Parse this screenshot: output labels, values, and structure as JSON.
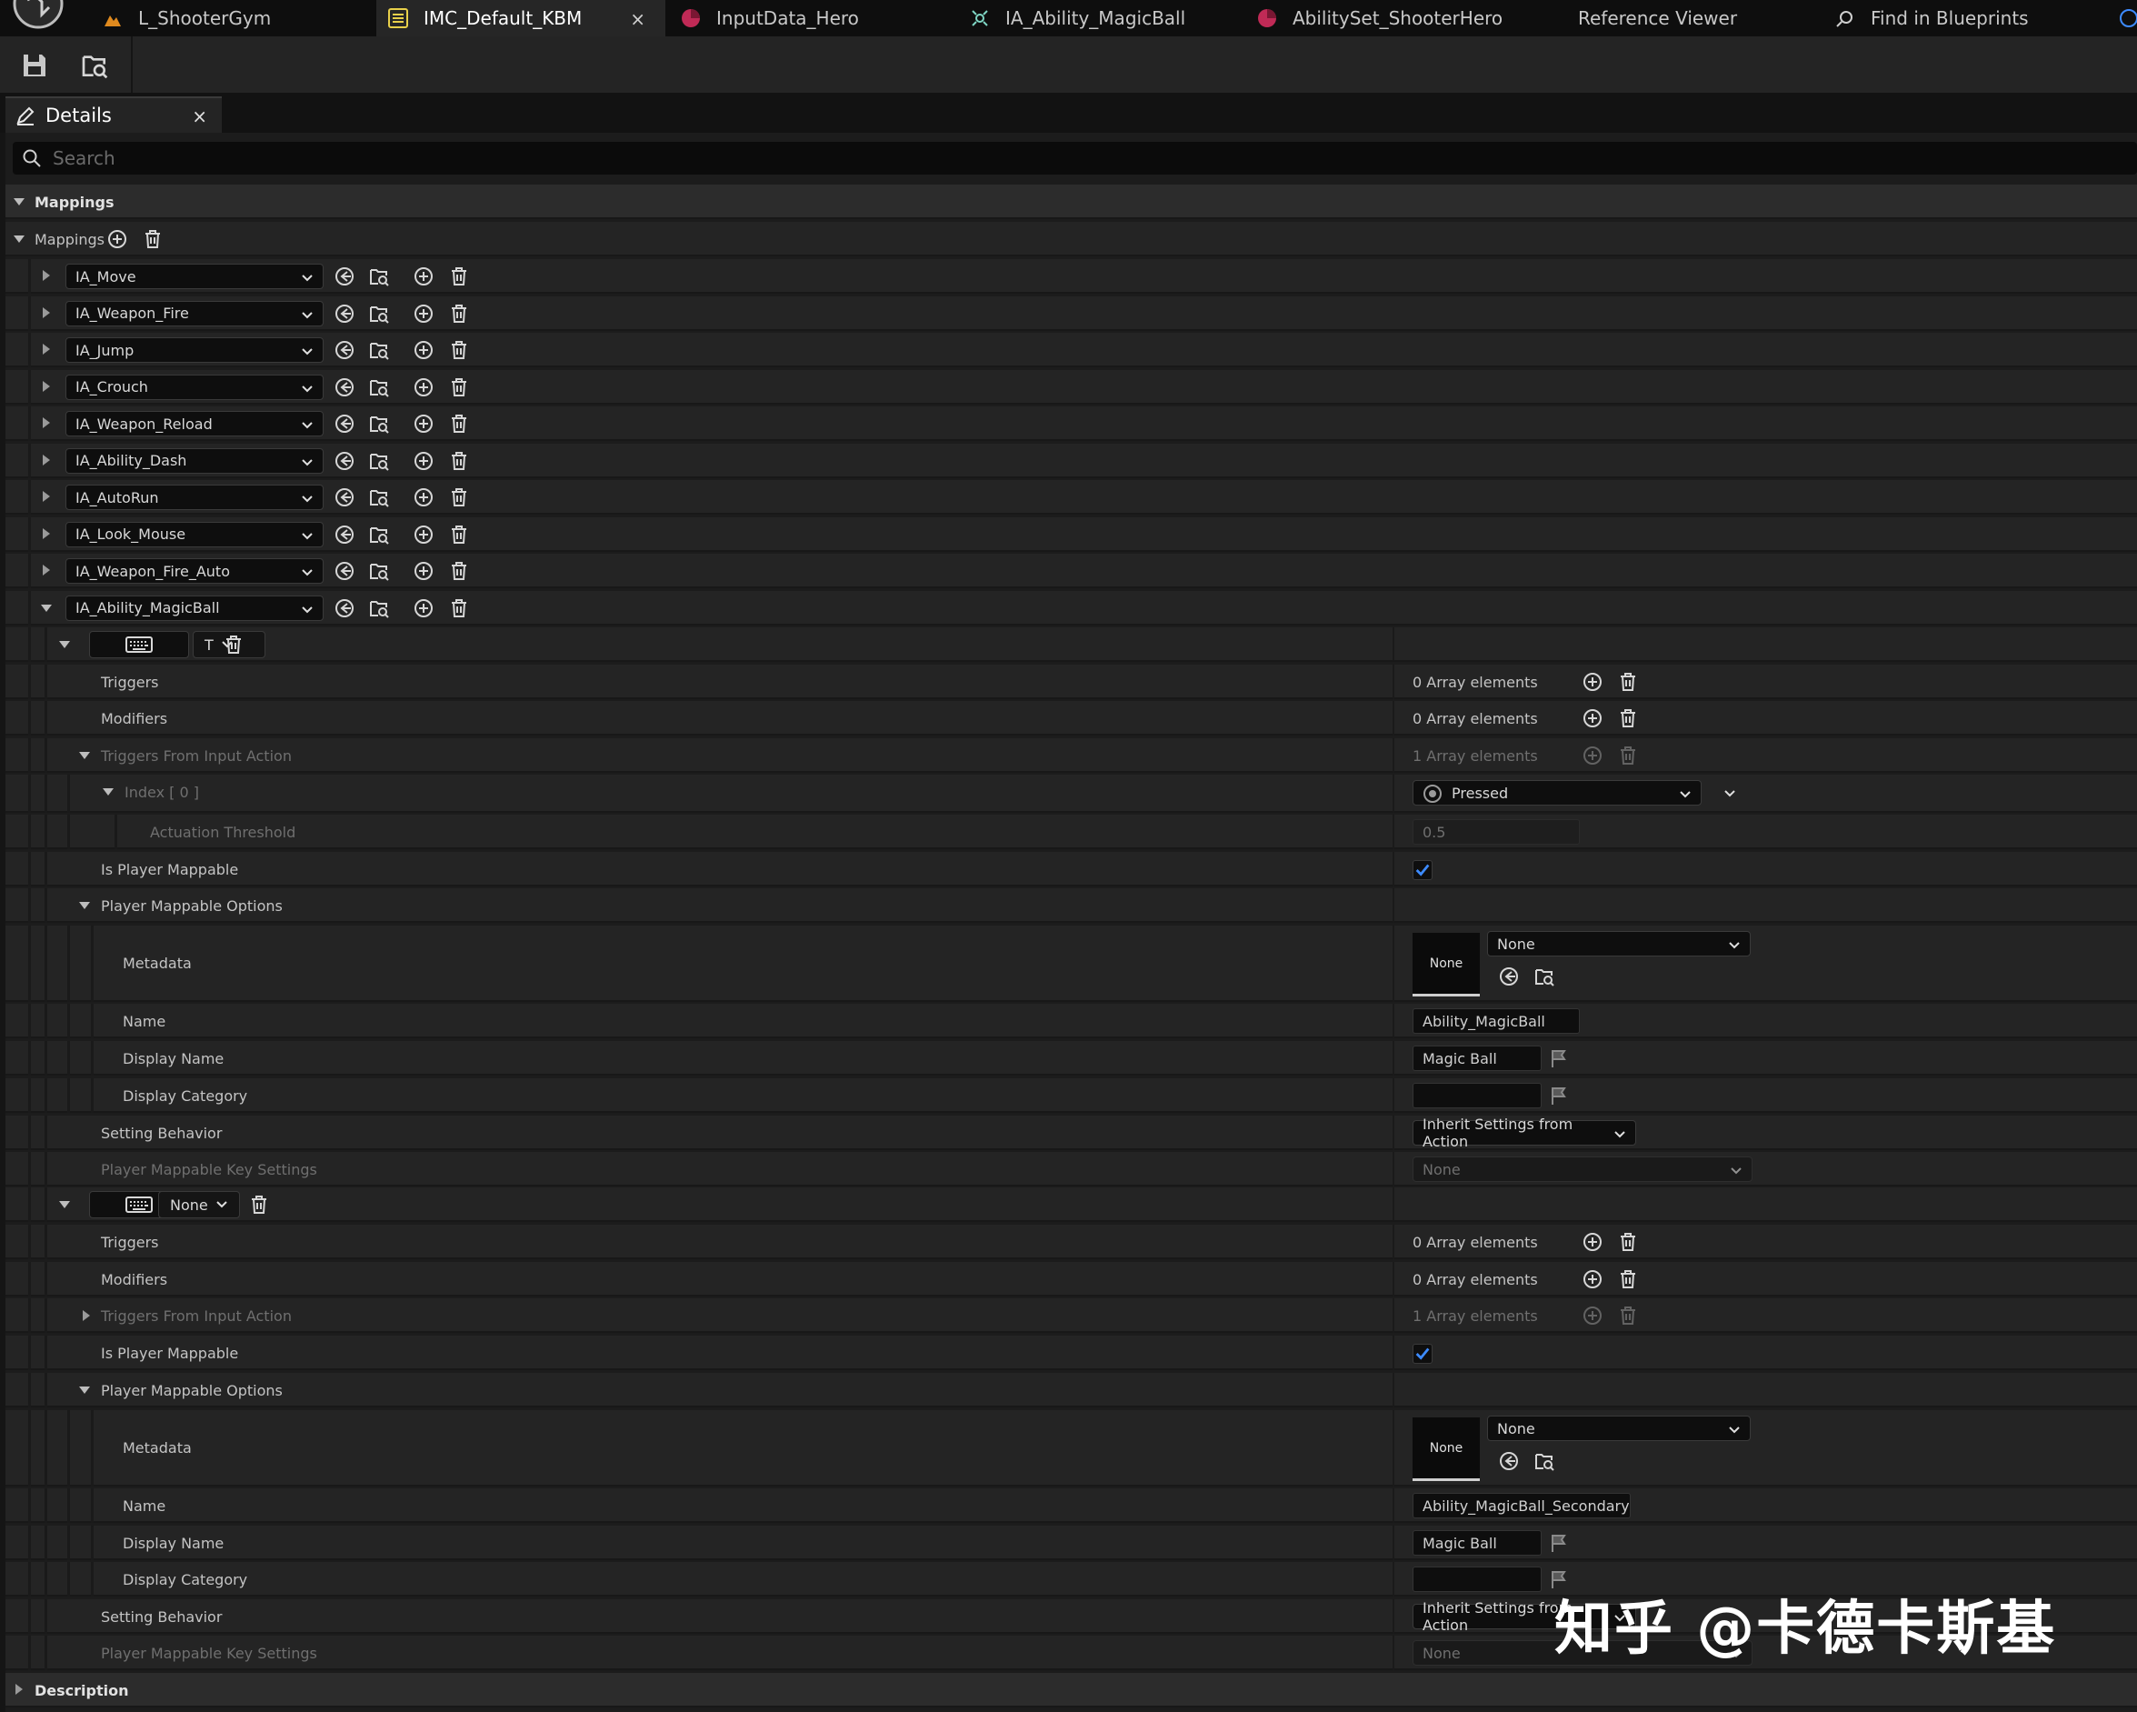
{
  "tabs": [
    {
      "label": "L_ShooterGym",
      "icon": "level-icon",
      "active": false
    },
    {
      "label": "IMC_Default_KBM",
      "icon": "input-mapping-context-icon",
      "active": true,
      "close": "×"
    },
    {
      "label": "InputData_Hero",
      "icon": "data-asset-icon",
      "active": false
    },
    {
      "label": "IA_Ability_MagicBall",
      "icon": "input-action-icon",
      "active": false
    },
    {
      "label": "AbilitySet_ShooterHero",
      "icon": "data-asset-icon",
      "active": false
    },
    {
      "label": "Reference Viewer",
      "icon": "",
      "active": false
    },
    {
      "label": "Find in Blueprints",
      "icon": "find-icon",
      "active": false
    }
  ],
  "toolbar": {
    "save_icon": "save-icon",
    "browse_icon": "browse-asset-icon"
  },
  "details": {
    "title": "Details",
    "close": "×",
    "search_placeholder": "Search"
  },
  "categories": {
    "mappings": "Mappings",
    "description": "Description"
  },
  "mappings_header": {
    "label": "Mappings"
  },
  "actions": [
    "IA_Move",
    "IA_Weapon_Fire",
    "IA_Jump",
    "IA_Crouch",
    "IA_Weapon_Reload",
    "IA_Ability_Dash",
    "IA_AutoRun",
    "IA_Look_Mouse",
    "IA_Weapon_Fire_Auto",
    "IA_Ability_MagicBall"
  ],
  "mapping1": {
    "key": "T",
    "triggers": {
      "label": "Triggers",
      "value": "0 Array elements"
    },
    "modifiers": {
      "label": "Modifiers",
      "value": "0 Array elements"
    },
    "triggers_from_action": {
      "label": "Triggers From Input Action",
      "value": "1 Array elements"
    },
    "index": {
      "label": "Index [ 0 ]",
      "value": "Pressed"
    },
    "actuation": {
      "label": "Actuation Threshold",
      "value": "0.5"
    },
    "is_player_mappable": {
      "label": "Is Player Mappable",
      "checked": true
    },
    "pmo": {
      "label": "Player Mappable Options"
    },
    "metadata": {
      "label": "Metadata",
      "thumb": "None",
      "value": "None"
    },
    "name": {
      "label": "Name",
      "value": "Ability_MagicBall"
    },
    "display_name": {
      "label": "Display Name",
      "value": "Magic Ball"
    },
    "display_category": {
      "label": "Display Category",
      "value": ""
    },
    "setting_behavior": {
      "label": "Setting Behavior",
      "value": "Inherit Settings from Action"
    },
    "key_settings": {
      "label": "Player Mappable Key Settings",
      "value": "None"
    }
  },
  "mapping2": {
    "key": "None",
    "triggers": {
      "label": "Triggers",
      "value": "0 Array elements"
    },
    "modifiers": {
      "label": "Modifiers",
      "value": "0 Array elements"
    },
    "triggers_from_action": {
      "label": "Triggers From Input Action",
      "value": "1 Array elements"
    },
    "is_player_mappable": {
      "label": "Is Player Mappable",
      "checked": true
    },
    "pmo": {
      "label": "Player Mappable Options"
    },
    "metadata": {
      "label": "Metadata",
      "thumb": "None",
      "value": "None"
    },
    "name": {
      "label": "Name",
      "value": "Ability_MagicBall_Secondary"
    },
    "display_name": {
      "label": "Display Name",
      "value": "Magic Ball"
    },
    "display_category": {
      "label": "Display Category",
      "value": ""
    },
    "setting_behavior": {
      "label": "Setting Behavior",
      "value": "Inherit Settings from Action"
    },
    "key_settings": {
      "label": "Player Mappable Key Settings",
      "value": "None"
    }
  },
  "watermark": "知乎 @卡德卡斯基",
  "colors": {
    "accent_check": "#3d8bff",
    "tab_active": "#262626",
    "panel": "#242424"
  }
}
